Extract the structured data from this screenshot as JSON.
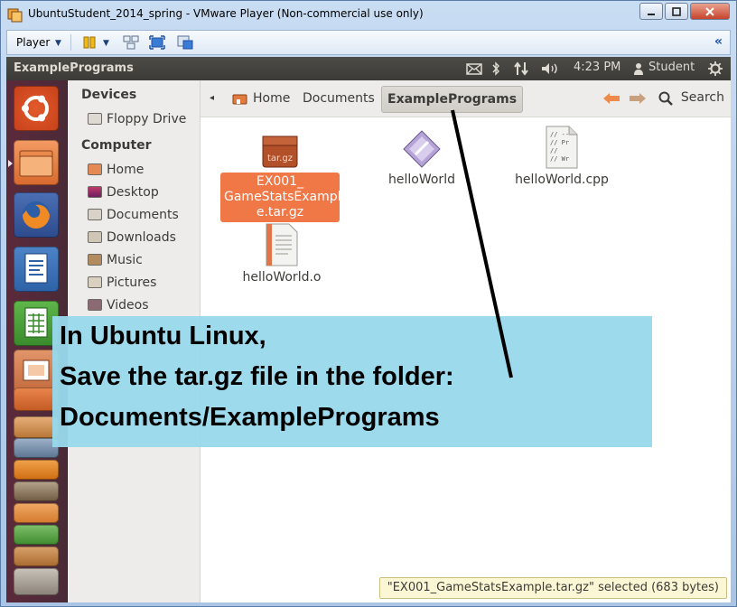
{
  "window": {
    "title": "UbuntuStudent_2014_spring - VMware Player (Non-commercial use only)",
    "controls": {
      "minimize": "▭",
      "restore": "▢",
      "close": "✕"
    }
  },
  "toolbar": {
    "player_label": "Player"
  },
  "panel": {
    "app_title": "ExamplePrograms",
    "time": "4:23 PM",
    "user": "Student"
  },
  "sidebar": {
    "devices_header": "Devices",
    "computer_header": "Computer",
    "devices": [
      {
        "label": "Floppy Drive",
        "icon": "floppy-icon"
      }
    ],
    "places": [
      {
        "label": "Home",
        "icon": "home-folder-icon"
      },
      {
        "label": "Desktop",
        "icon": "desktop-icon"
      },
      {
        "label": "Documents",
        "icon": "documents-folder-icon"
      },
      {
        "label": "Downloads",
        "icon": "downloads-folder-icon"
      },
      {
        "label": "Music",
        "icon": "music-folder-icon"
      },
      {
        "label": "Pictures",
        "icon": "pictures-folder-icon"
      },
      {
        "label": "Videos",
        "icon": "videos-folder-icon"
      }
    ]
  },
  "pathbar": {
    "crumbs": [
      "Home",
      "Documents",
      "ExamplePrograms"
    ],
    "search_label": "Search"
  },
  "files": [
    {
      "name": "EX001_\nGameStatsExampl\ne.tar.gz",
      "icon": "tar-gz-archive-icon",
      "icon_text": "tar.gz",
      "selected": true
    },
    {
      "name": "helloWorld",
      "icon": "executable-icon",
      "selected": false
    },
    {
      "name": "helloWorld.cpp",
      "icon": "cpp-source-icon",
      "icon_text": "// --\n// Pr\n//\n// Wr",
      "selected": false
    },
    {
      "name": "helloWorld.o",
      "icon": "object-file-icon",
      "selected": false
    }
  ],
  "status": "\"EX001_GameStatsExample.tar.gz\" selected (683 bytes)",
  "callout": {
    "lines": [
      "In Ubuntu Linux,",
      "Save the tar.gz file in the folder:",
      "Documents/ExamplePrograms"
    ]
  },
  "colors": {
    "selection": "#f07746",
    "panel": "#3c3b37",
    "launcher": "#4f2a39",
    "callout": "#98d8eb"
  }
}
